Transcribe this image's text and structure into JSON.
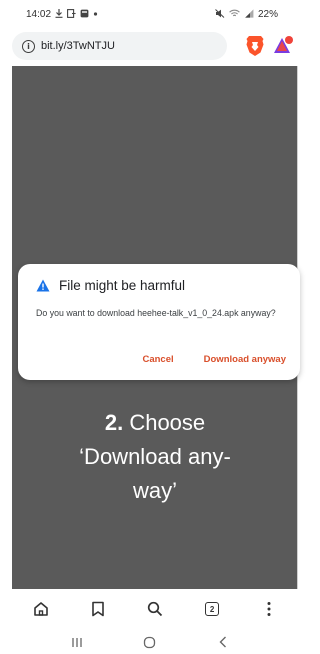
{
  "status_bar": {
    "time": "14:02",
    "notification_icons": [
      "download-icon",
      "screen-mirror-icon",
      "gallery-icon",
      "dot-icon"
    ],
    "system_icons": [
      "mute-icon",
      "wifi-icon",
      "signal-icon"
    ],
    "battery": "22%"
  },
  "url_bar": {
    "url": "bit.ly/3TwNTJU",
    "icons": [
      "info-icon",
      "brave-shield-icon",
      "brave-rewards-icon"
    ]
  },
  "dialog": {
    "title": "File might be harmful",
    "message": "Do you want to download heehee-talk_v1_0_24.apk anyway?",
    "cancel_label": "Cancel",
    "confirm_label": "Download anyway",
    "accent_color": "#d94f2b",
    "warning_color": "#1a73e8"
  },
  "instruction": {
    "step_number": "2.",
    "line1_rest": " Choose",
    "line2": "‘Download any-",
    "line3": "way’"
  },
  "bottom_toolbar": {
    "items": [
      "home-icon",
      "bookmark-icon",
      "search-icon",
      "tabs-icon",
      "menu-icon"
    ],
    "tab_count": "2"
  },
  "nav_bar": {
    "items": [
      "recents-icon",
      "home-circle-icon",
      "back-icon"
    ]
  }
}
